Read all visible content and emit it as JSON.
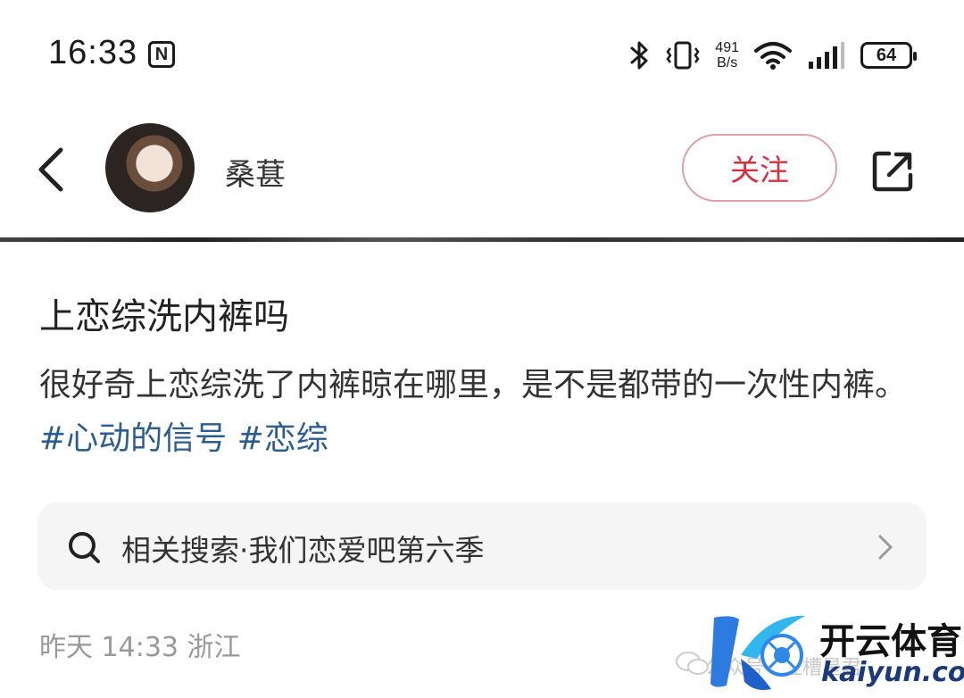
{
  "status_bar": {
    "time": "16:33",
    "nfc_label": "N",
    "net_speed_value": "491",
    "net_speed_unit": "B/s",
    "battery": "64"
  },
  "header": {
    "username": "桑葚",
    "follow_label": "关注"
  },
  "post": {
    "title": "上恋综洗内裤吗",
    "body": "很好奇上恋综洗了内裤晾在哪里，是不是都带的一次性内裤。",
    "tags": [
      "#心动的信号",
      "#恋综"
    ]
  },
  "related_search": {
    "text": "相关搜索·我们恋爱吧第六季"
  },
  "meta": {
    "date": "昨天 14:33 浙江"
  },
  "watermark": {
    "brand": "开云体育",
    "domain": "kaiyun.com",
    "sub_text": "公众号 · 吐槽星君"
  },
  "colors": {
    "accent": "#d4303f",
    "tag": "#2b5d8f",
    "follow_border": "#e0a0a8"
  }
}
